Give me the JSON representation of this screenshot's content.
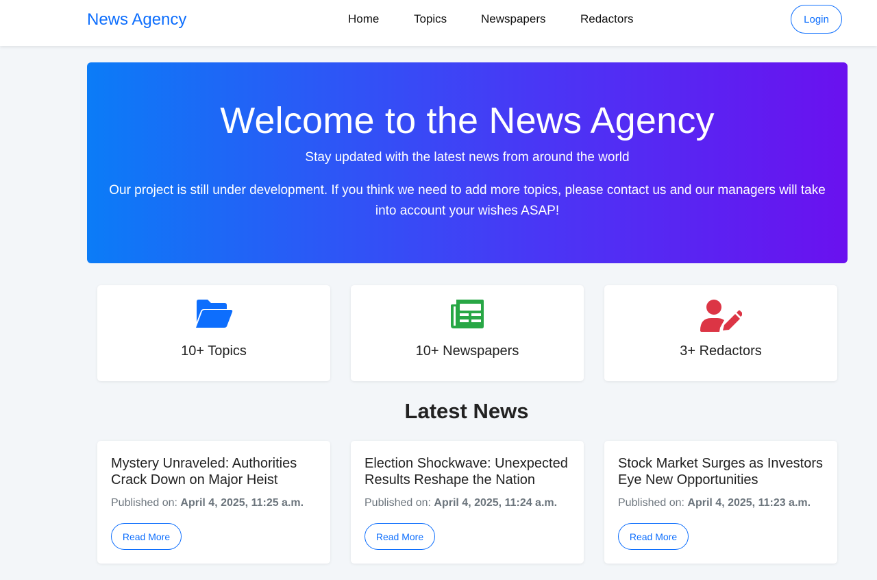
{
  "navbar": {
    "brand": "News Agency",
    "links": [
      "Home",
      "Topics",
      "Newspapers",
      "Redactors"
    ],
    "login": "Login"
  },
  "hero": {
    "title": "Welcome to the News Agency",
    "subtitle": "Stay updated with the latest news from around the world",
    "text": "Our project is still under development. If you think we need to add more topics, please contact us and our managers will take into account your wishes ASAP!"
  },
  "stats": [
    {
      "label": "10+ Topics",
      "icon": "folder-open-icon",
      "color": "#0d6efd"
    },
    {
      "label": "10+ Newspapers",
      "icon": "newspaper-icon",
      "color": "#28a745"
    },
    {
      "label": "3+ Redactors",
      "icon": "user-pen-icon",
      "color": "#dc3545"
    }
  ],
  "latest": {
    "title": "Latest News",
    "published_label": "Published on:",
    "read_more": "Read More",
    "items": [
      {
        "title": "Mystery Unraveled: Authorities Crack Down on Major Heist",
        "date": "April 4, 2025, 11:25 a.m."
      },
      {
        "title": "Election Shockwave: Unexpected Results Reshape the Nation",
        "date": "April 4, 2025, 11:24 a.m."
      },
      {
        "title": "Stock Market Surges as Investors Eye New Opportunities",
        "date": "April 4, 2025, 11:23 a.m."
      }
    ]
  },
  "colors": {
    "accent": "#0d6efd",
    "hero_gradient_start": "#0b7cf7",
    "hero_gradient_end": "#6a11ef",
    "background": "#f3f6f9"
  }
}
